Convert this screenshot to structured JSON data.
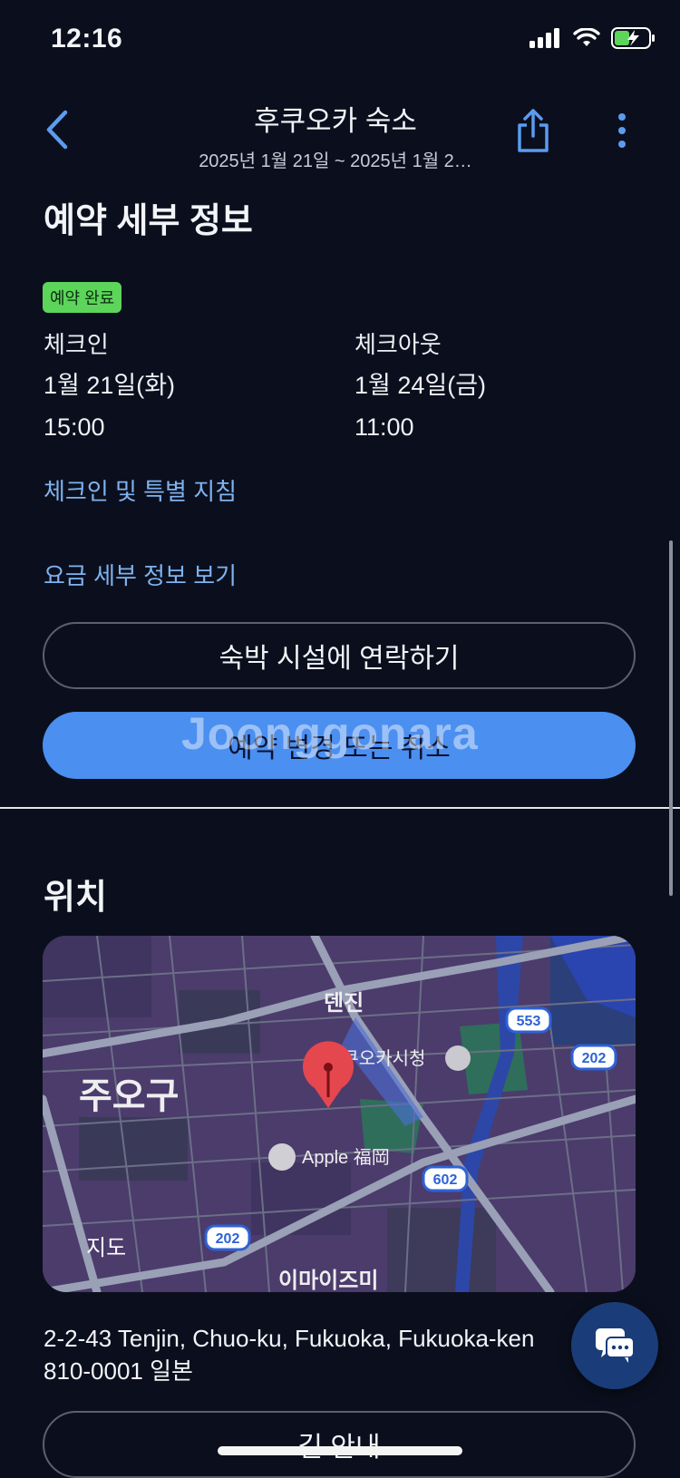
{
  "status_bar": {
    "time": "12:16"
  },
  "header": {
    "title": "후쿠오카 숙소",
    "subtitle": "2025년 1월 21일 ~ 2025년 1월 2…"
  },
  "booking": {
    "section_title": "예약 세부 정보",
    "badge": "예약 완료",
    "checkin_label": "체크인",
    "checkin_date": "1월 21일(화)",
    "checkin_time": "15:00",
    "checkout_label": "체크아웃",
    "checkout_date": "1월 24일(금)",
    "checkout_time": "11:00",
    "instructions_link": "체크인 및 특별 지침",
    "price_link": "요금 세부 정보 보기",
    "contact_button": "숙박 시설에 연락하기",
    "change_button": "예약 변경 또는 취소",
    "watermark": "Joonggonara"
  },
  "location": {
    "section_title": "위치",
    "map": {
      "district": "주오구",
      "area_label": "덴진",
      "city_hall": "후쿠오카시청",
      "poi": "Apple 福岡",
      "bottom_label": "이마이즈미",
      "maps_brand": "지도",
      "route_553": "553",
      "route_202_top": "202",
      "route_602": "602",
      "route_202_bottom": "202"
    },
    "address_line1": "2-2-43 Tenjin, Chuo-ku, Fukuoka, Fukuoka-ken",
    "address_line2": "810-0001 일본",
    "directions_button": "길 안내"
  },
  "icons": {
    "back": "chevron-left-icon",
    "share": "share-icon",
    "more": "more-vertical-icon",
    "chat": "chat-icon"
  },
  "colors": {
    "background": "#0b0f1d",
    "accent": "#4b8ff0",
    "link": "#7fb3f0",
    "badge": "#5cd55a"
  }
}
